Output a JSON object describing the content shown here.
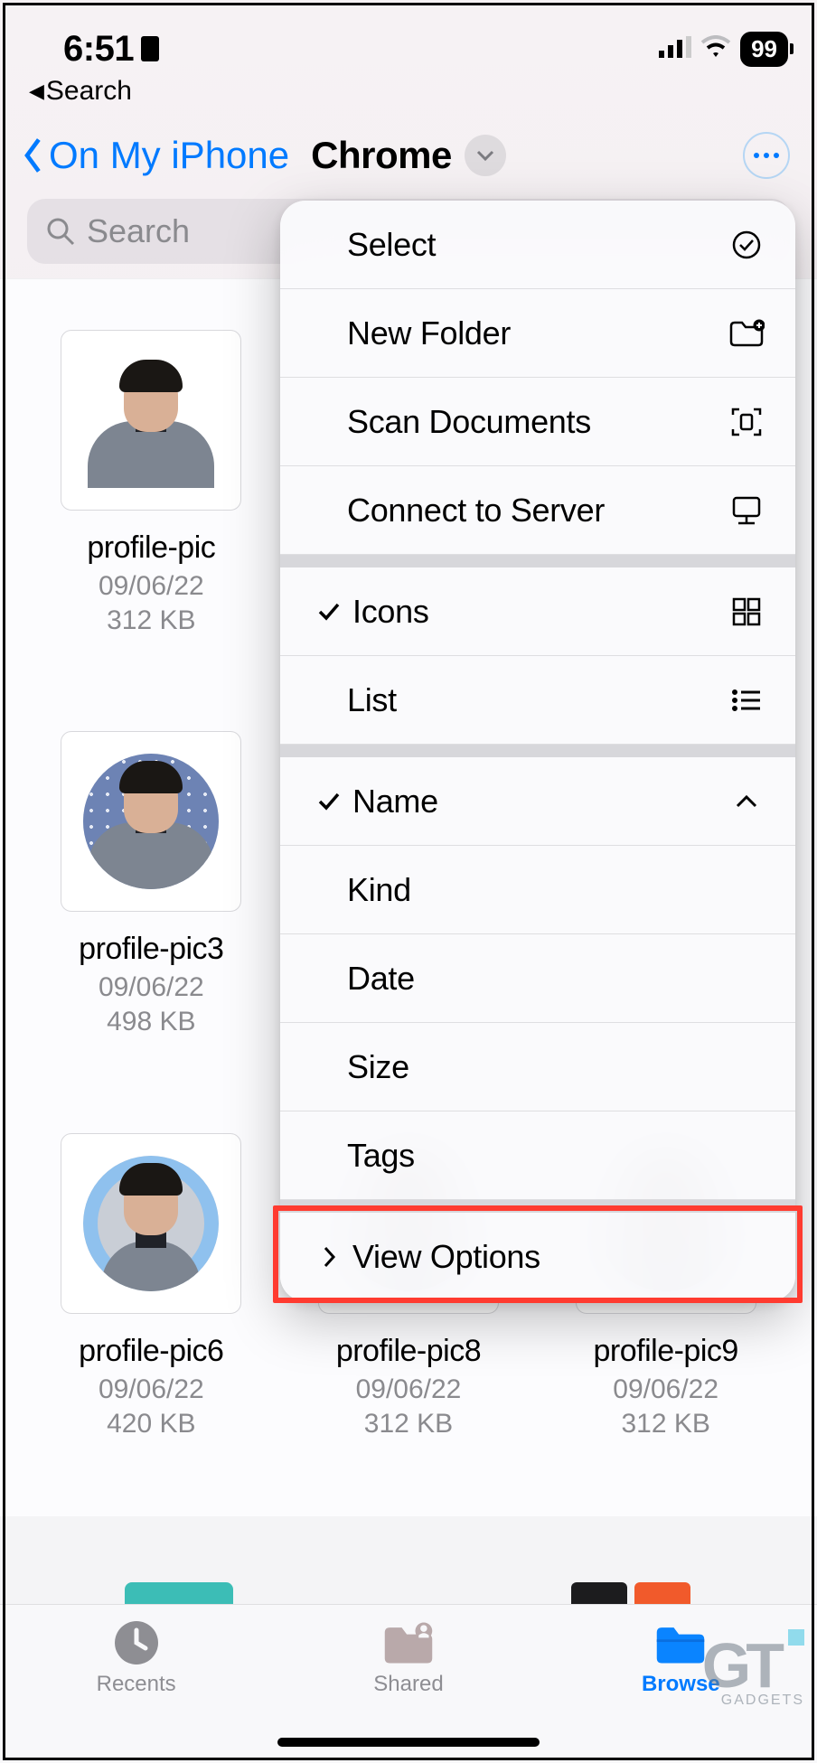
{
  "status": {
    "time": "6:51",
    "battery": "99"
  },
  "backApp": "Search",
  "nav": {
    "back": "On My iPhone",
    "title": "Chrome"
  },
  "search": {
    "placeholder": "Search"
  },
  "files": [
    {
      "name": "profile-pic",
      "date": "09/06/22",
      "size": "312 KB",
      "variant": "plain-square"
    },
    {
      "name": "",
      "date": "",
      "size": "",
      "variant": "hidden"
    },
    {
      "name": "",
      "date": "",
      "size": "",
      "variant": "hidden"
    },
    {
      "name": "profile-pic3",
      "date": "09/06/22",
      "size": "498 KB",
      "variant": "pattern"
    },
    {
      "name": "",
      "date": "",
      "size": "",
      "variant": "hidden"
    },
    {
      "name": "",
      "date": "",
      "size": "",
      "variant": "hidden"
    },
    {
      "name": "profile-pic6",
      "date": "09/06/22",
      "size": "420 KB",
      "variant": "ring"
    },
    {
      "name": "profile-pic8",
      "date": "09/06/22",
      "size": "312 KB",
      "variant": "plain"
    },
    {
      "name": "profile-pic9",
      "date": "09/06/22",
      "size": "312 KB",
      "variant": "plain"
    }
  ],
  "menu": {
    "select": "Select",
    "newFolder": "New Folder",
    "scan": "Scan Documents",
    "connect": "Connect to Server",
    "icons": "Icons",
    "list": "List",
    "name": "Name",
    "kind": "Kind",
    "date": "Date",
    "size": "Size",
    "tags": "Tags",
    "viewOptions": "View Options"
  },
  "tabs": {
    "recents": "Recents",
    "shared": "Shared",
    "browse": "Browse"
  },
  "watermark": {
    "brand": "GT",
    "sub": "GADGETS"
  }
}
